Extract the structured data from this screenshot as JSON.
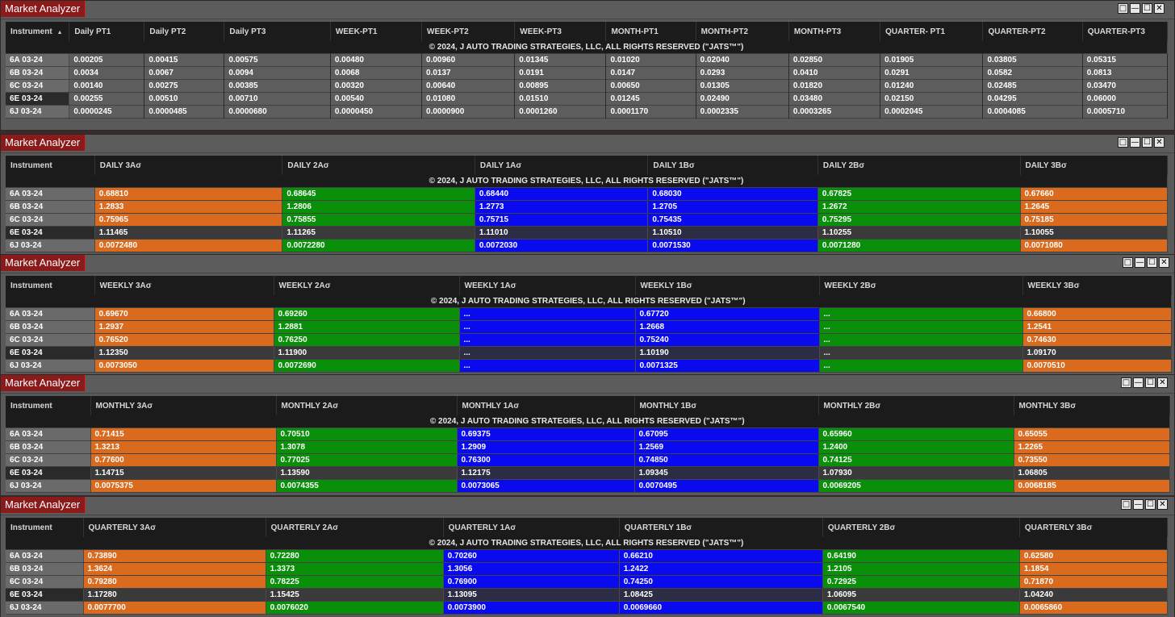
{
  "app_title": "Market Analyzer",
  "copyright": "© 2024, J AUTO TRADING STRATEGIES, LLC, ALL RIGHTS RESERVED (\"JATS™\")",
  "instrument_header": "Instrument",
  "instruments": [
    "6A 03-24",
    "6B 03-24",
    "6C 03-24",
    "6E 03-24",
    "6J 03-24"
  ],
  "colors": {
    "orange": "#d96a1e",
    "green": "#0a8f0a",
    "blue": "#0a0aee",
    "title_red": "#8b1a1a"
  },
  "window_buttons": [
    "□",
    "—",
    "☐",
    "✕"
  ],
  "targets": {
    "columns": [
      "Daily PT1",
      "Daily PT2",
      "Daily PT3",
      "WEEK-PT1",
      "WEEK-PT2",
      "WEEK-PT3",
      "MONTH-PT1",
      "MONTH-PT2",
      "MONTH-PT3",
      "QUARTER- PT1",
      "QUARTER-PT2",
      "QUARTER-PT3"
    ],
    "rows": [
      [
        "0.00205",
        "0.00415",
        "0.00575",
        "0.00480",
        "0.00960",
        "0.01345",
        "0.01020",
        "0.02040",
        "0.02850",
        "0.01905",
        "0.03805",
        "0.05315"
      ],
      [
        "0.0034",
        "0.0067",
        "0.0094",
        "0.0068",
        "0.0137",
        "0.0191",
        "0.0147",
        "0.0293",
        "0.0410",
        "0.0291",
        "0.0582",
        "0.0813"
      ],
      [
        "0.00140",
        "0.00275",
        "0.00385",
        "0.00320",
        "0.00640",
        "0.00895",
        "0.00650",
        "0.01305",
        "0.01820",
        "0.01240",
        "0.02485",
        "0.03470"
      ],
      [
        "0.00255",
        "0.00510",
        "0.00710",
        "0.00540",
        "0.01080",
        "0.01510",
        "0.01245",
        "0.02490",
        "0.03480",
        "0.02150",
        "0.04295",
        "0.06000"
      ],
      [
        "0.0000245",
        "0.0000485",
        "0.0000680",
        "0.0000450",
        "0.0000900",
        "0.0001260",
        "0.0001170",
        "0.0002335",
        "0.0003265",
        "0.0002045",
        "0.0004085",
        "0.0005710"
      ]
    ]
  },
  "daily": {
    "columns": [
      "DAILY 3Aσ",
      "DAILY 2Aσ",
      "DAILY 1Aσ",
      "DAILY 1Bσ",
      "DAILY 2Bσ",
      "DAILY 3Bσ"
    ],
    "rows": [
      [
        "0.68810",
        "0.68645",
        "0.68440",
        "0.68030",
        "0.67825",
        "0.67660"
      ],
      [
        "1.2833",
        "1.2806",
        "1.2773",
        "1.2705",
        "1.2672",
        "1.2645"
      ],
      [
        "0.75965",
        "0.75855",
        "0.75715",
        "0.75435",
        "0.75295",
        "0.75185"
      ],
      [
        "1.11465",
        "1.11265",
        "1.11010",
        "1.10510",
        "1.10255",
        "1.10055"
      ],
      [
        "0.0072480",
        "0.0072280",
        "0.0072030",
        "0.0071530",
        "0.0071280",
        "0.0071080"
      ]
    ]
  },
  "weekly": {
    "columns": [
      "WEEKLY 3Aσ",
      "WEEKLY 2Aσ",
      "WEEKLY 1Aσ",
      "WEEKLY 1Bσ",
      "WEEKLY 2Bσ",
      "WEEKLY 3Bσ"
    ],
    "rows": [
      [
        "0.69670",
        "0.69260",
        "...",
        "0.67720",
        "...",
        "0.66800"
      ],
      [
        "1.2937",
        "1.2881",
        "...",
        "1.2668",
        "...",
        "1.2541"
      ],
      [
        "0.76520",
        "0.76250",
        "...",
        "0.75240",
        "...",
        "0.74630"
      ],
      [
        "1.12350",
        "1.11900",
        "...",
        "1.10190",
        "...",
        "1.09170"
      ],
      [
        "0.0073050",
        "0.0072690",
        "...",
        "0.0071325",
        "...",
        "0.0070510"
      ]
    ]
  },
  "monthly": {
    "columns": [
      "MONTHLY 3Aσ",
      "MONTHLY 2Aσ",
      "MONTHLY 1Aσ",
      "MONTHLY 1Bσ",
      "MONTHLY 2Bσ",
      "MONTHLY 3Bσ"
    ],
    "rows": [
      [
        "0.71415",
        "0.70510",
        "0.69375",
        "0.67095",
        "0.65960",
        "0.65055"
      ],
      [
        "1.3213",
        "1.3078",
        "1.2909",
        "1.2569",
        "1.2400",
        "1.2265"
      ],
      [
        "0.77600",
        "0.77025",
        "0.76300",
        "0.74850",
        "0.74125",
        "0.73550"
      ],
      [
        "1.14715",
        "1.13590",
        "1.12175",
        "1.09345",
        "1.07930",
        "1.06805"
      ],
      [
        "0.0075375",
        "0.0074355",
        "0.0073065",
        "0.0070495",
        "0.0069205",
        "0.0068185"
      ]
    ]
  },
  "quarterly": {
    "columns": [
      "QUARTERLY 3Aσ",
      "QUARTERLY 2Aσ",
      "QUARTERLY 1Aσ",
      "QUARTERLY 1Bσ",
      "QUARTERLY 2Bσ",
      "QUARTERLY 3Bσ"
    ],
    "rows": [
      [
        "0.73890",
        "0.72280",
        "0.70260",
        "0.66210",
        "0.64190",
        "0.62580"
      ],
      [
        "1.3624",
        "1.3373",
        "1.3056",
        "1.2422",
        "1.2105",
        "1.1854"
      ],
      [
        "0.79280",
        "0.78225",
        "0.76900",
        "0.74250",
        "0.72925",
        "0.71870"
      ],
      [
        "1.17280",
        "1.15425",
        "1.13095",
        "1.08425",
        "1.06095",
        "1.04240"
      ],
      [
        "0.0077700",
        "0.0076020",
        "0.0073900",
        "0.0069660",
        "0.0067540",
        "0.0065860"
      ]
    ]
  }
}
